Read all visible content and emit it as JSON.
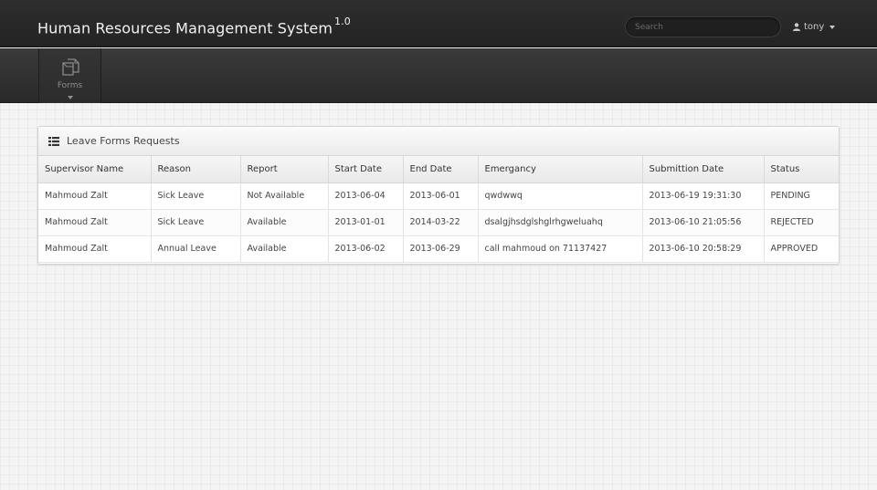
{
  "header": {
    "title": "Human Resources Management System",
    "version": "1.0",
    "search_placeholder": "Search",
    "user_name": "tony"
  },
  "nav": {
    "items": [
      {
        "label": "Forms",
        "icon": "forms-icon"
      }
    ]
  },
  "panel": {
    "title": "Leave Forms Requests",
    "icon": "list-icon"
  },
  "table": {
    "columns": [
      "Supervisor Name",
      "Reason",
      "Report",
      "Start Date",
      "End Date",
      "Emergancy",
      "Submittion Date",
      "Status"
    ],
    "rows": [
      [
        "Mahmoud Zalt",
        "Sick Leave",
        "Not Available",
        "2013-06-04",
        "2013-06-01",
        "qwdwwq",
        "2013-06-19 19:31:30",
        "PENDING"
      ],
      [
        "Mahmoud Zalt",
        "Sick Leave",
        "Available",
        "2013-01-01",
        "2014-03-22",
        "dsalgjhsdglshglrhgweluahq",
        "2013-06-10 21:05:56",
        "REJECTED"
      ],
      [
        "Mahmoud Zalt",
        "Annual Leave",
        "Available",
        "2013-06-02",
        "2013-06-29",
        "call mahmoud on 71137427",
        "2013-06-10 20:58:29",
        "APPROVED"
      ]
    ]
  }
}
